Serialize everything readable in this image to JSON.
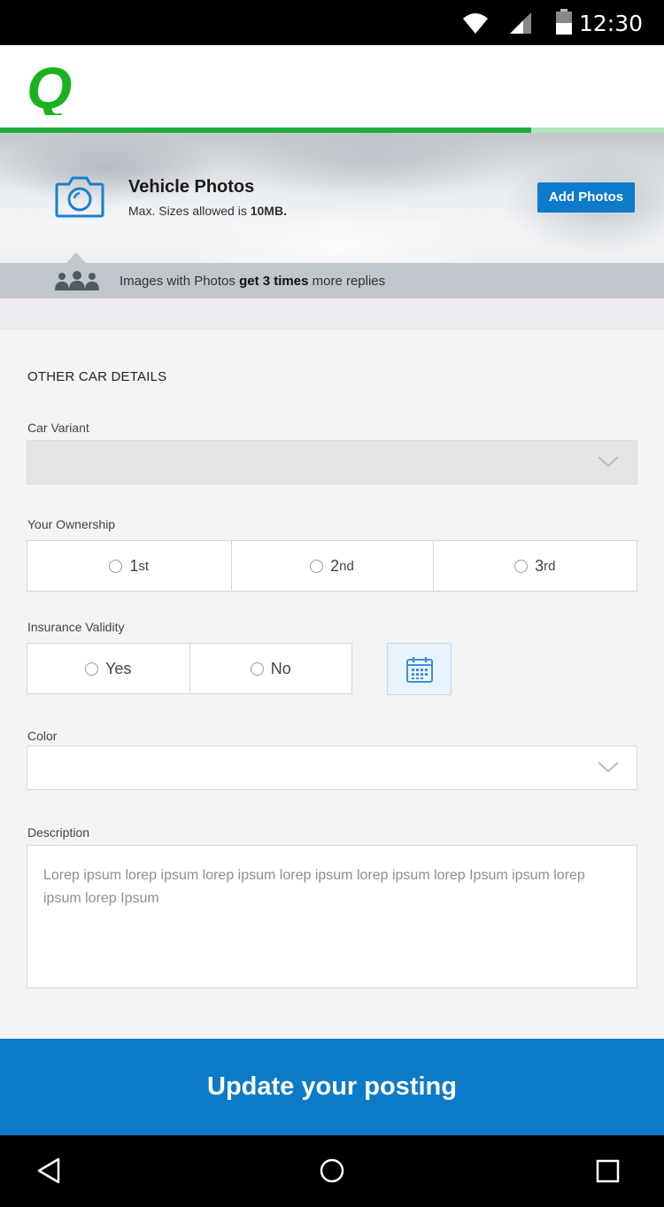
{
  "status_bar": {
    "time": "12:30",
    "icons": [
      "wifi-icon",
      "signal-icon",
      "battery-icon"
    ]
  },
  "header": {
    "logo_letter": "Q",
    "logo_color": "#18b21f",
    "progress": 0.8
  },
  "photo_banner": {
    "title": "Vehicle Photos",
    "subtitle_prefix": "Max. Sizes allowed is ",
    "subtitle_bold": "10MB.",
    "button_label": "Add Photos",
    "tip_prefix": "Images with Photos ",
    "tip_bold": "get 3 times",
    "tip_suffix": " more replies"
  },
  "form": {
    "section_title": "OTHER CAR DETAILS",
    "car_variant": {
      "label": "Car Variant",
      "value": ""
    },
    "ownership": {
      "label": "Your Ownership",
      "options": [
        {
          "num": "1",
          "suffix": "st"
        },
        {
          "num": "2",
          "suffix": "nd"
        },
        {
          "num": "3",
          "suffix": "rd"
        }
      ]
    },
    "insurance": {
      "label": "Insurance Validity",
      "options": [
        "Yes",
        "No"
      ]
    },
    "color": {
      "label": "Color",
      "value": ""
    },
    "description": {
      "label": "Description",
      "value": "Lorep ipsum lorep ipsum lorep ipsum lorep ipsum lorep ipsum lorep Ipsum ipsum lorep ipsum lorep Ipsum"
    }
  },
  "cta": {
    "label": "Update your posting",
    "color": "#0c7bc7"
  },
  "nav_bar": {
    "icons": [
      "back-icon",
      "home-icon",
      "recents-icon"
    ]
  }
}
